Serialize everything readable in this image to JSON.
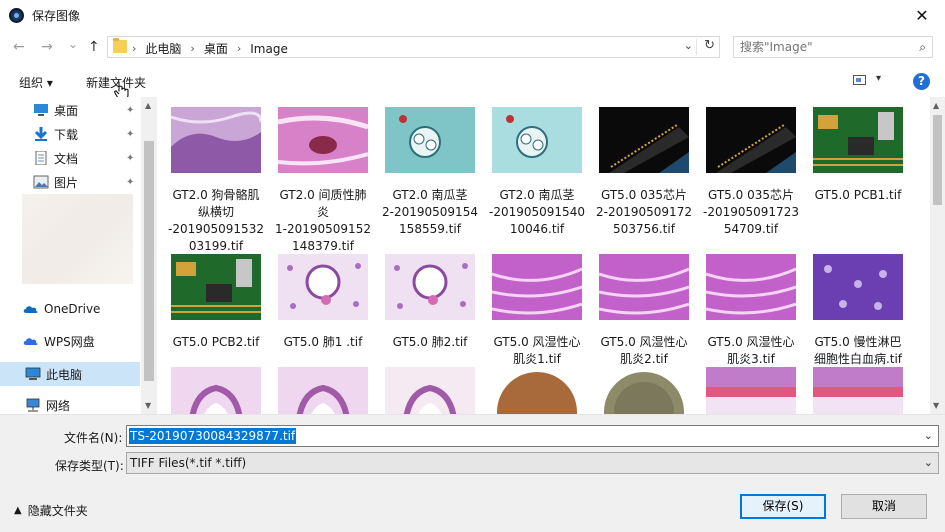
{
  "window": {
    "title": "保存图像",
    "close": "✕"
  },
  "nav": {
    "back": "←",
    "forward": "→",
    "recent": "⌄",
    "up": "↑"
  },
  "address": {
    "crumb_sep": "›",
    "crumbs": [
      "此电脑",
      "桌面",
      "Image"
    ],
    "dropdown": "⌄",
    "refresh": "↻"
  },
  "search": {
    "placeholder": "搜索\"Image\"",
    "icon": "⌕"
  },
  "toolbar": {
    "organize": "组织 ▾",
    "new_folder": "新建文件夹",
    "view_drop": "▾",
    "help": "?"
  },
  "sidebar": {
    "quick": [
      {
        "label": "桌面",
        "icon": "desktop-icon"
      },
      {
        "label": "下载",
        "icon": "download-icon"
      },
      {
        "label": "文档",
        "icon": "document-icon"
      },
      {
        "label": "图片",
        "icon": "picture-icon"
      }
    ],
    "pin": "📌",
    "onedrive": "OneDrive",
    "wps": "WPS网盘",
    "this_pc": "此电脑",
    "network": "网络",
    "up": "▲",
    "down": "▼"
  },
  "files": [
    {
      "label": "GT2.0  狗骨骼肌\n纵横切\n-201905091532\n03199.tif",
      "kind": "muscle"
    },
    {
      "label": "GT2.0  间质性肺\n炎\n1-20190509152\n148379.tif",
      "kind": "lung-pink"
    },
    {
      "label": "GT2.0  南瓜茎\n2-20190509154\n158559.tif",
      "kind": "stem-cyan"
    },
    {
      "label": "GT2.0  南瓜茎\n-201905091540\n10046.tif",
      "kind": "stem-cyan2"
    },
    {
      "label": "GT5.0  035芯片\n2-20190509172\n503756.tif",
      "kind": "chip"
    },
    {
      "label": "GT5.0  035芯片\n-201905091723\n54709.tif",
      "kind": "chip2"
    },
    {
      "label": "GT5.0   PCB1.tif",
      "kind": "pcb"
    },
    {
      "label": "GT5.0   PCB2.tif",
      "kind": "pcb"
    },
    {
      "label": "GT5.0 肺1 .tif",
      "kind": "lung"
    },
    {
      "label": "GT5.0 肺2.tif",
      "kind": "lung"
    },
    {
      "label": "GT5.0 风湿性心\n肌炎1.tif",
      "kind": "myo"
    },
    {
      "label": "GT5.0 风湿性心\n肌炎2.tif",
      "kind": "myo"
    },
    {
      "label": "GT5.0 风湿性心\n肌炎3.tif",
      "kind": "myo"
    },
    {
      "label": "GT5.0 慢性淋巴\n细胞性白血病.tif",
      "kind": "leuk"
    },
    {
      "label": "",
      "kind": "intestine"
    },
    {
      "label": "",
      "kind": "intestine"
    },
    {
      "label": "",
      "kind": "intestine-light"
    },
    {
      "label": "",
      "kind": "coin-copper"
    },
    {
      "label": "",
      "kind": "coin-silver"
    },
    {
      "label": "",
      "kind": "tissue-band"
    },
    {
      "label": "",
      "kind": "tissue-band"
    }
  ],
  "scroll": {
    "up": "▲",
    "down": "▼"
  },
  "bottom": {
    "filename_label": "文件名(N):",
    "filename_value": "TS-20190730084329877.tif",
    "filetype_label": "保存类型(T):",
    "filetype_value": "TIFF Files(*.tif *.tiff)",
    "drop": "⌄",
    "hide_folders": "隐藏文件夹",
    "hide_chev": "▲",
    "save": "保存(S)",
    "cancel": "取消"
  }
}
